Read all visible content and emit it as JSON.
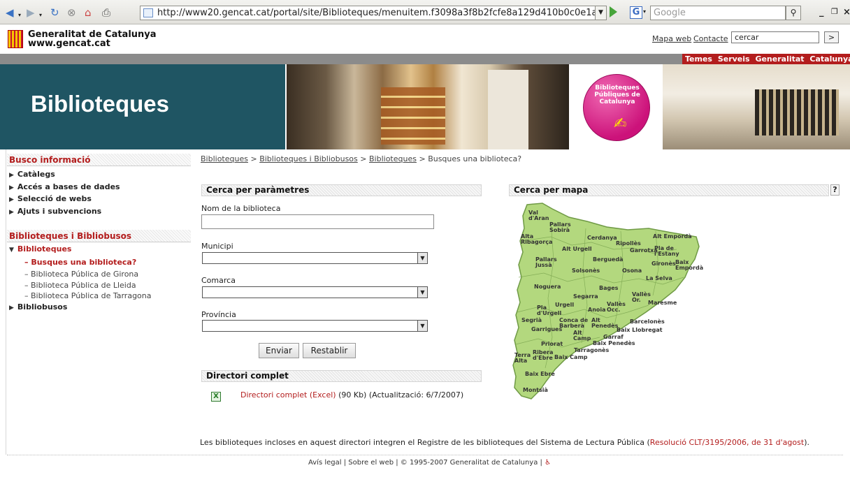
{
  "browser": {
    "url": "http://www20.gencat.cat/portal/site/Biblioteques/menuitem.f3098a3f8b2fcfe8a129d410b0c0e1a0/?vg",
    "search_placeholder": "Google",
    "google_icon": "G"
  },
  "header": {
    "logo_line1": "Generalitat de Catalunya",
    "logo_line2": "www.gencat.cat",
    "link_mapa": "Mapa web",
    "link_contacte": "Contacte",
    "search_value": "cercar",
    "search_btn": ">",
    "nav": [
      "Temes",
      "Serveis",
      "Generalitat",
      "Catalunya"
    ]
  },
  "banner": {
    "title": "Biblioteques",
    "circle_text": "Biblioteques Públiques de Catalunya"
  },
  "sidebar": {
    "section1_title": "Busco informació",
    "section1_items": [
      "Catàlegs",
      "Accés a bases de dades",
      "Selecció de webs",
      "Ajuts i subvencions"
    ],
    "section2_title": "Biblioteques i Bibliobusos",
    "biblioteques_label": "Biblioteques",
    "sub_items": [
      "Busques una biblioteca?",
      "Biblioteca Pública de Girona",
      "Biblioteca Pública de Lleida",
      "Biblioteca Pública de Tarragona"
    ],
    "bibliobusos_label": "Bibliobusos"
  },
  "breadcrumb": {
    "items": [
      "Biblioteques",
      "Biblioteques i Bibliobusos",
      "Biblioteques"
    ],
    "separator": ">",
    "current": "Busques una biblioteca?"
  },
  "search_form": {
    "title": "Cerca per paràmetres",
    "name_label": "Nom de la biblioteca",
    "municipi_label": "Municipi",
    "comarca_label": "Comarca",
    "provincia_label": "Província",
    "submit": "Enviar",
    "reset": "Restablir"
  },
  "directory": {
    "title": "Directori complet",
    "link": "Directori complet (Excel)",
    "info": "(90 Kb) (Actualització: 6/7/2007)"
  },
  "map": {
    "title": "Cerca per mapa",
    "help": "?",
    "regions": [
      "Val d'Aran",
      "Pallars Sobirà",
      "Alta Ribagorça",
      "Cerdanya",
      "Alt Empordà",
      "Ripollès",
      "Alt Urgell",
      "Garrotxa",
      "Pla de l'Estany",
      "Pallars Jussà",
      "Berguedà",
      "Gironès",
      "Baix Empordà",
      "Solsonès",
      "Osona",
      "La Selva",
      "Noguera",
      "Bages",
      "Segarra",
      "Vallès Or.",
      "Maresme",
      "Pla d'Urgell",
      "Urgell",
      "Anoia",
      "Vallès Occ.",
      "Segrià",
      "Conca de Barberà",
      "Alt Penedès",
      "Barcelonès",
      "Garrigues",
      "Alt Camp",
      "Baix Llobregat",
      "Garraf",
      "Priorat",
      "Baix Penedès",
      "Tarragonès",
      "Ribera d'Ebre",
      "Terra Alta",
      "Baix Camp",
      "Baix Ebre",
      "Montsià"
    ]
  },
  "footnote": {
    "text": "Les biblioteques incloses en aquest directori integren el Registre de les biblioteques del Sistema de Lectura Pública (",
    "link": "Resolució CLT/3195/2006, de 31 d'agost",
    "end": ")."
  },
  "footer": {
    "text": "Avís legal | Sobre el web | © 1995-2007 Generalitat de Catalunya |"
  }
}
